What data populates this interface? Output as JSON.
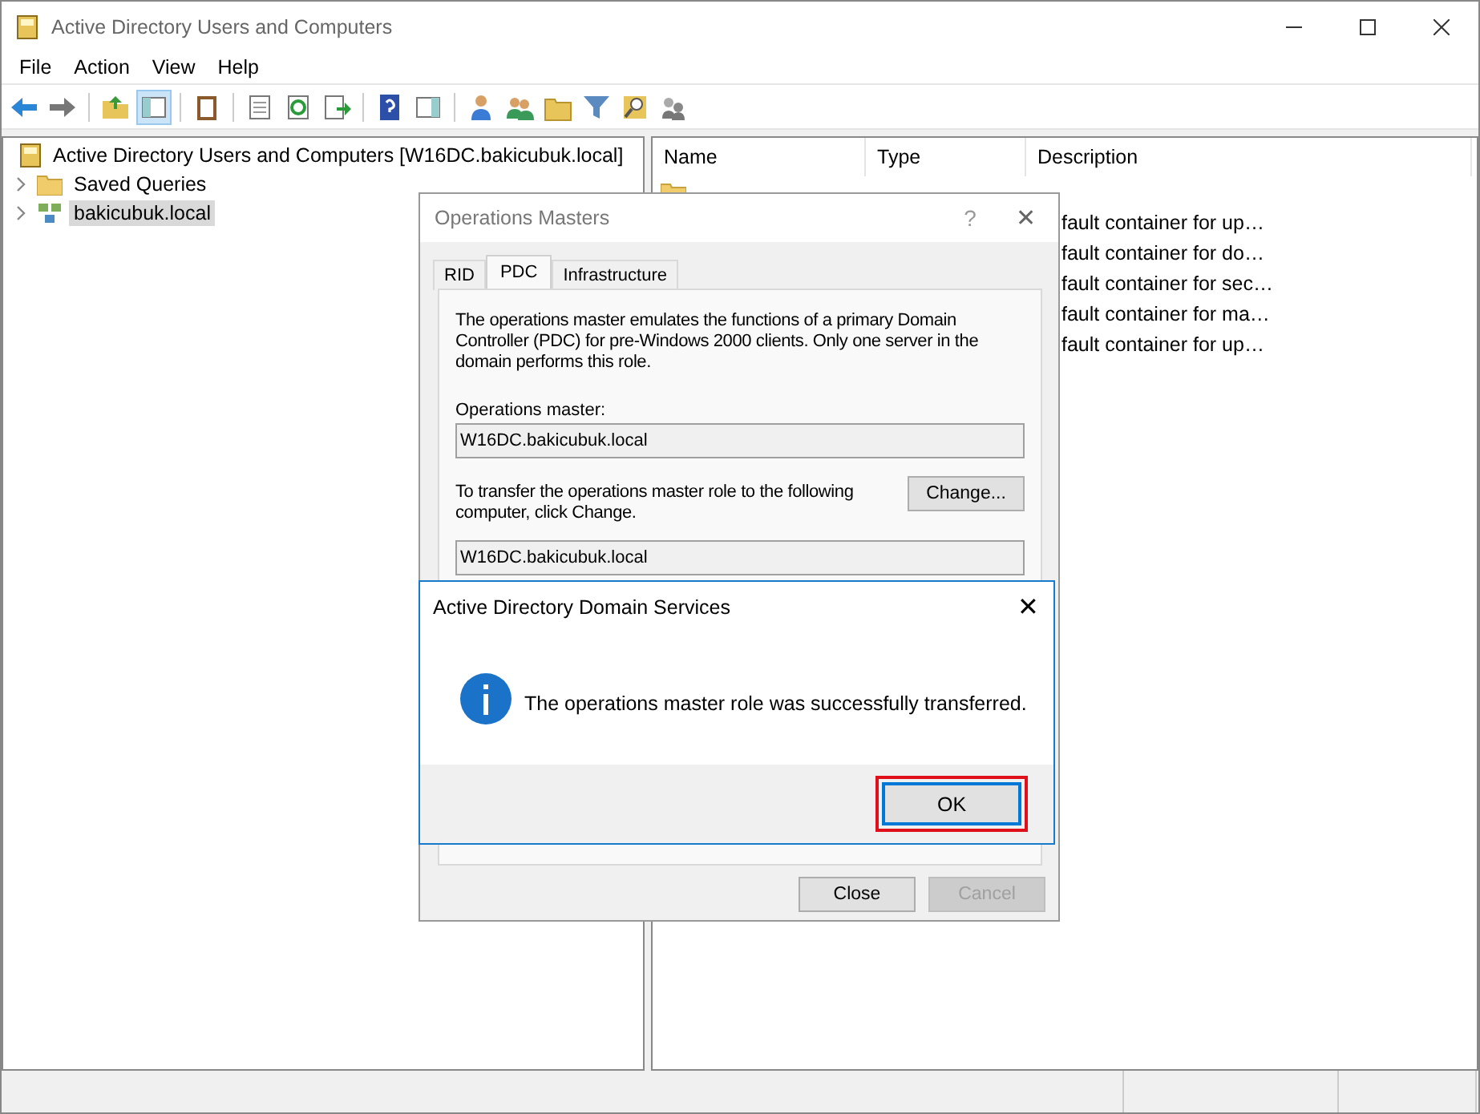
{
  "window": {
    "title": "Active Directory Users and Computers"
  },
  "menu": [
    "File",
    "Action",
    "View",
    "Help"
  ],
  "toolbar": {
    "console_tree_pressed": true
  },
  "tree": [
    {
      "label": "Active Directory Users and Computers [W16DC.bakicubuk.local]",
      "selected": false,
      "children": [
        {
          "label": "Saved Queries",
          "expanded": false,
          "selected": false
        },
        {
          "label": "bakicubuk.local",
          "expanded": false,
          "selected": true
        }
      ]
    }
  ],
  "list": {
    "columns": [
      "Name",
      "Type",
      "Description"
    ],
    "rows": [
      {
        "kind": "folder"
      },
      {
        "description": "fault container for up…"
      },
      {
        "description": "fault container for do…"
      },
      {
        "description": "fault container for sec…"
      },
      {
        "description": "fault container for ma…"
      },
      {
        "description": "fault container for up…"
      }
    ]
  },
  "operations_dialog": {
    "title": "Operations Masters",
    "help": "?",
    "close": "✕",
    "tabs": [
      {
        "label": "RID",
        "selected": false
      },
      {
        "label": "PDC",
        "selected": true
      },
      {
        "label": "Infrastructure",
        "selected": false
      }
    ],
    "description": "The operations master emulates the functions of a primary Domain Controller (PDC) for pre-Windows 2000 clients. Only one server in the domain performs this role.",
    "master_label": "Operations master:",
    "master_value": "W16DC.bakicubuk.local",
    "transfer_text": "To transfer the operations master role to the following computer, click Change.",
    "change_button": "Change...",
    "target_value": "W16DC.bakicubuk.local",
    "buttons": [
      {
        "label": "Close",
        "disabled": false
      },
      {
        "label": "Cancel",
        "disabled": true
      }
    ]
  },
  "message_box": {
    "title": "Active Directory Domain Services",
    "close": "✕",
    "message": "The operations master role was successfully transferred.",
    "ok": "OK",
    "highlighted": true
  }
}
